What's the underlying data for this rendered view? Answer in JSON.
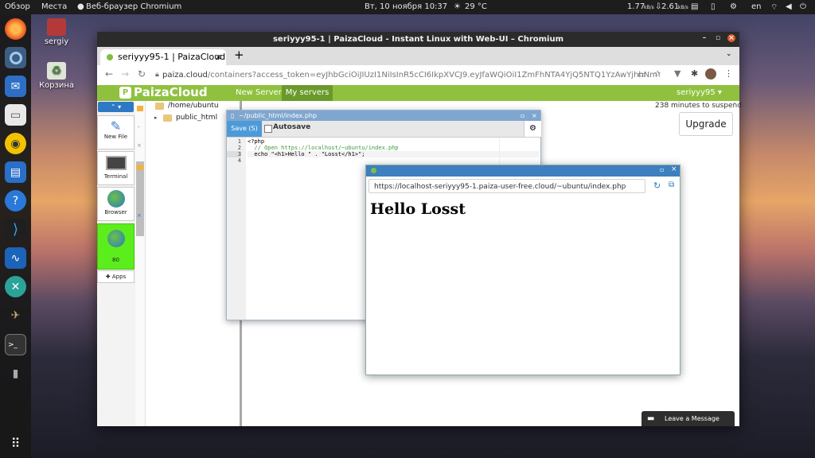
{
  "topbar": {
    "overview": "Обзор",
    "places": "Места",
    "app_name": "Веб-браузер Chromium",
    "datetime": "Вт, 10 ноября  10:37",
    "weather": "29 °C",
    "net_up": "1.77",
    "net_up_unit": "kB/s",
    "net_down": "2.61",
    "net_down_unit": "kB/s",
    "lang": "en"
  },
  "desktop": {
    "home_label": "sergiy",
    "trash_label": "Корзина"
  },
  "browser": {
    "window_title": "seriyyy95-1 | PaizaCloud - Instant Linux with Web-UI – Chromium",
    "tab_title": "seriyyy95-1 | PaizaCloud",
    "new_tab": "+",
    "url_host": "paiza.cloud",
    "url_path": "/containers?access_token=eyJhbGciOiJIUzI1NiIsInR5cCI6IkpXVCJ9.eyJfaWQiOiI1ZmFhNTA4YjQ5NTQ1YzAwYjhhNmYwODEi..."
  },
  "paiza": {
    "logo": "PaizaCloud",
    "nav_new_server": "New Server",
    "nav_my_servers": "My servers",
    "user": "seriyyy95",
    "suspend_text": "238 minutes to suspend",
    "upgrade": "Upgrade",
    "tools": {
      "new_file": "New File",
      "terminal": "Terminal",
      "browser": "Browser",
      "port": "80",
      "apps": "Apps"
    },
    "tree": {
      "root": "/home/ubuntu",
      "child": "public_html"
    }
  },
  "editor": {
    "title": "~/public_html/index.php",
    "save": "Save (S)",
    "autosave": "Autosave",
    "line_numbers": [
      "1",
      "2",
      "3",
      "4"
    ],
    "lines": [
      "<?php",
      "  // Open https://localhost/~ubuntu/index.php",
      "  echo \"<h1>Hello \" . \"Losst</h1>\";",
      ""
    ]
  },
  "preview": {
    "url": "https://localhost-seriyyy95-1.paiza-user-free.cloud/~ubuntu/index.php",
    "heading": "Hello Losst"
  },
  "chat": {
    "label": "Leave a Message"
  }
}
